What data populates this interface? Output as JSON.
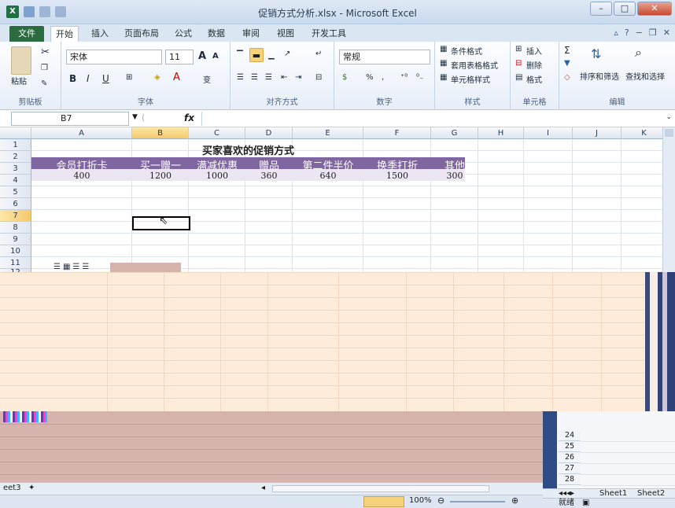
{
  "window": {
    "title": "促销方式分析.xlsx - Microsoft Excel"
  },
  "ribbon_tabs": [
    "文件",
    "开始",
    "插入",
    "页面布局",
    "公式",
    "数据",
    "审阅",
    "视图",
    "开发工具"
  ],
  "ribbon": {
    "clipboard": {
      "paste": "粘贴",
      "label": "剪贴板"
    },
    "font": {
      "name": "宋体",
      "size": "11",
      "bold": "B",
      "italic": "I",
      "underline": "U",
      "grow": "A",
      "shrink": "A",
      "wen": "变",
      "label": "字体"
    },
    "align": {
      "label": "对齐方式"
    },
    "number": {
      "format": "常规",
      "percent": "%",
      "comma": ",",
      "label": "数字"
    },
    "styles": {
      "conditional": "条件格式",
      "table": "套用表格格式",
      "cell": "单元格样式",
      "label": "样式"
    },
    "cells": {
      "insert": "插入",
      "delete": "删除",
      "format": "格式",
      "label": "单元格"
    },
    "editing": {
      "sum": "Σ",
      "sort": "排序和筛选",
      "find": "查找和选择",
      "label": "编辑"
    }
  },
  "formula_bar": {
    "name_box": "B7",
    "fx": "fx",
    "value": ""
  },
  "columns": [
    "A",
    "B",
    "C",
    "D",
    "E",
    "F",
    "G",
    "H",
    "I",
    "J",
    "K"
  ],
  "rows": [
    "1",
    "2",
    "3",
    "4",
    "5",
    "6",
    "7",
    "8",
    "9",
    "10",
    "11",
    "12"
  ],
  "sheet": {
    "title": "买家喜欢的促销方式",
    "headers": [
      "会员打折卡",
      "买一赠一",
      "满减优惠",
      "赠品",
      "第二件半价",
      "换季打折",
      "其他"
    ],
    "values": [
      "400",
      "1200",
      "1000",
      "360",
      "640",
      "1500",
      "300"
    ]
  },
  "status": {
    "zoom": "100%",
    "ready": "就绪"
  },
  "sheet_tabs": {
    "left_fragment": "eet3",
    "right": [
      "Sheet1",
      "Sheet2"
    ]
  },
  "fragment_rows": [
    "24",
    "25",
    "26",
    "27",
    "28"
  ],
  "colors": {
    "header_band": "#8066a0",
    "value_band": "#ece6f2",
    "selection": "#000000",
    "file_tab": "#2a6b3f"
  }
}
